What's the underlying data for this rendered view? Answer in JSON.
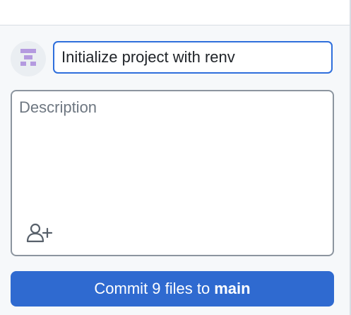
{
  "commit": {
    "summary_value": "Initialize project with renv",
    "description_placeholder": "Description",
    "button_prefix": "Commit 9 files to",
    "branch": "main"
  },
  "icons": {
    "avatar": "identicon-avatar",
    "coauthor": "add-coauthor-icon"
  },
  "colors": {
    "accent": "#2f6ad0",
    "focus_border": "#2f6fdc",
    "avatar_fill": "#b49adf"
  }
}
